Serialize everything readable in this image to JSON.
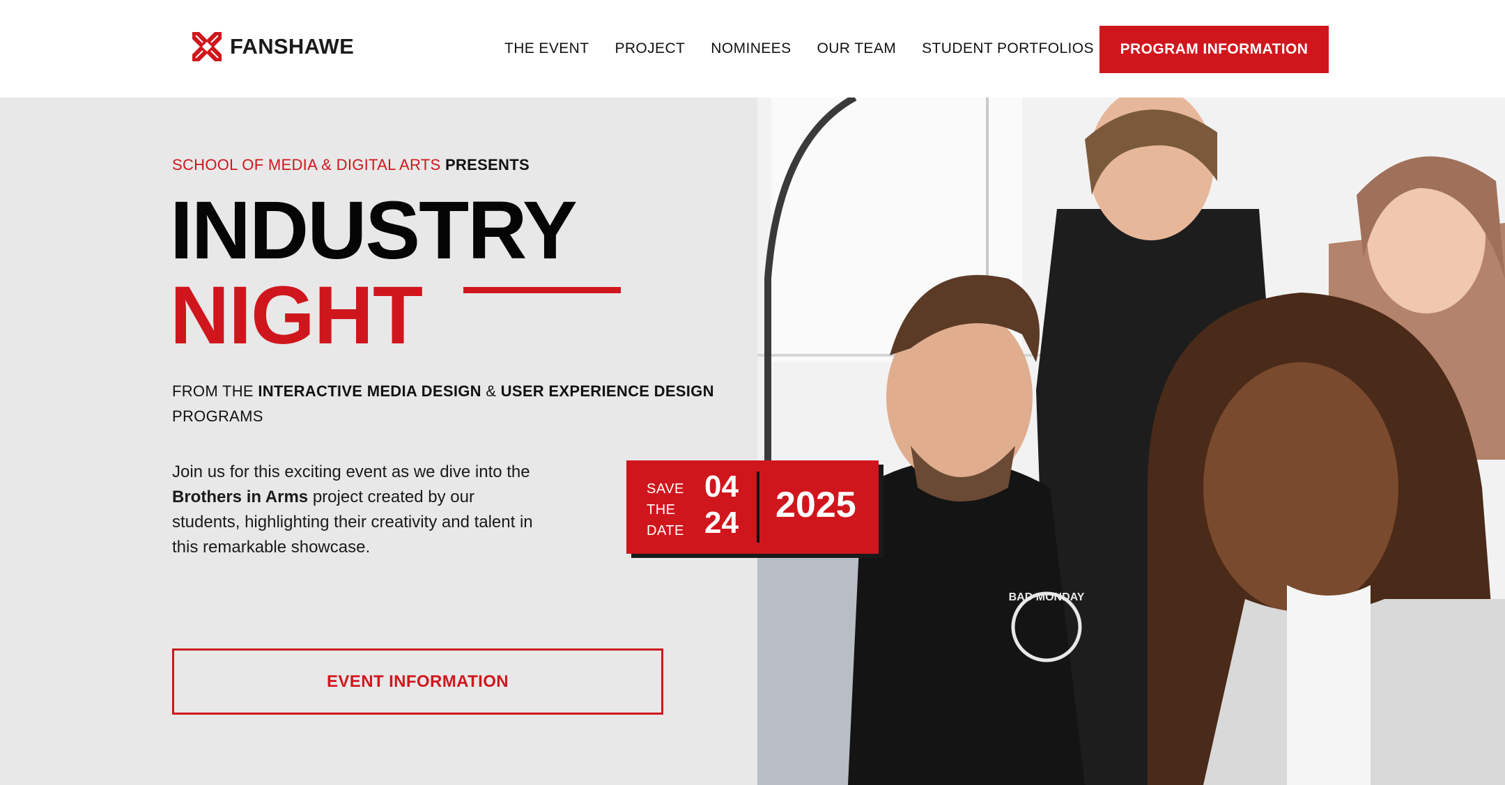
{
  "header": {
    "logo_text": "FANSHAWE",
    "nav": [
      {
        "label": "THE EVENT"
      },
      {
        "label": "PROJECT"
      },
      {
        "label": "NOMINEES"
      },
      {
        "label": "OUR TEAM"
      },
      {
        "label": "STUDENT PORTFOLIOS"
      }
    ],
    "cta_label": "PROGRAM INFORMATION"
  },
  "hero": {
    "presents_school": "SCHOOL OF MEDIA & DIGITAL ARTS",
    "presents_word": "PRESENTS",
    "title_line1": "INDUSTRY",
    "title_line2": "NIGHT",
    "programs_prefix": "FROM THE",
    "program_1": "INTERACTIVE MEDIA DESIGN",
    "programs_and": "&",
    "program_2": "USER EXPERIENCE DESIGN",
    "programs_suffix": "PROGRAMS",
    "desc_before": "Join us for this exciting event as we dive into the",
    "desc_project": "Brothers in Arms",
    "desc_after": "project created by our students, highlighting their creativity and talent in this remarkable showcase.",
    "event_button": "EVENT INFORMATION"
  },
  "save_date": {
    "line1": "SAVE",
    "line2": "THE",
    "line3": "DATE",
    "month": "04",
    "day": "24",
    "year": "2025"
  },
  "photo": {
    "shirt_text": "BAD MONDAY"
  },
  "colors": {
    "brand_red": "#d0161d",
    "panel_gray": "#e8e8e8",
    "text_dark": "#111111"
  }
}
